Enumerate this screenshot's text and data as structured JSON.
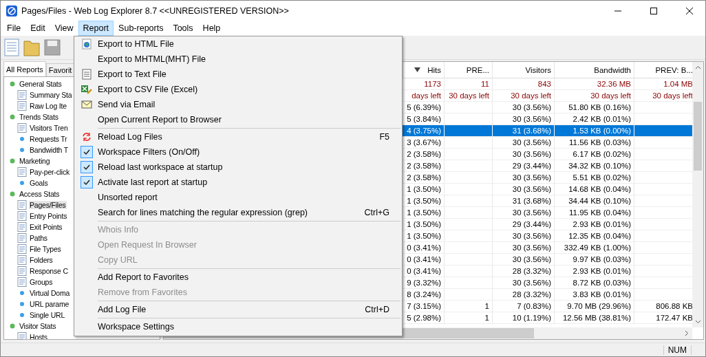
{
  "window": {
    "title": "Pages/Files - Web Log Explorer 8.7 <<UNREGISTERED VERSION>>"
  },
  "menubar": [
    {
      "label": "File",
      "selected": false
    },
    {
      "label": "Edit",
      "selected": false
    },
    {
      "label": "View",
      "selected": false
    },
    {
      "label": "Report",
      "selected": true
    },
    {
      "label": "Sub-reports",
      "selected": false
    },
    {
      "label": "Tools",
      "selected": false
    },
    {
      "label": "Help",
      "selected": false
    }
  ],
  "sidebar": {
    "tabs": [
      {
        "label": "All Reports",
        "selected": true
      },
      {
        "label": "Favorit",
        "selected": false
      }
    ],
    "tree": [
      {
        "label": "General Stats",
        "children": [
          {
            "label": "Summary Sta",
            "kind": "icon",
            "selected": false
          },
          {
            "label": "Raw Log Ite",
            "kind": "icon",
            "selected": false
          }
        ]
      },
      {
        "label": "Trends Stats",
        "children": [
          {
            "label": "Visitors Tren",
            "kind": "icon",
            "selected": false
          },
          {
            "label": "Requests Tr",
            "kind": "dot",
            "selected": false
          },
          {
            "label": "Bandwidth T",
            "kind": "dot",
            "selected": false
          }
        ]
      },
      {
        "label": "Marketing",
        "children": [
          {
            "label": "Pay-per-click",
            "kind": "icon",
            "selected": false
          },
          {
            "label": "Goals",
            "kind": "dot",
            "selected": false
          }
        ]
      },
      {
        "label": "Access Stats",
        "children": [
          {
            "label": "Pages/Files",
            "kind": "icon",
            "selected": true
          },
          {
            "label": "Entry Points",
            "kind": "icon",
            "selected": false
          },
          {
            "label": "Exit Points",
            "kind": "icon",
            "selected": false
          },
          {
            "label": "Paths",
            "kind": "icon",
            "selected": false
          },
          {
            "label": "File Types",
            "kind": "icon",
            "selected": false
          },
          {
            "label": "Folders",
            "kind": "icon",
            "selected": false
          },
          {
            "label": "Response C",
            "kind": "icon",
            "selected": false
          },
          {
            "label": "Groups",
            "kind": "icon",
            "selected": false
          },
          {
            "label": "Virtual Doma",
            "kind": "dot",
            "selected": false
          },
          {
            "label": "URL parame",
            "kind": "dot",
            "selected": false
          },
          {
            "label": "Single URL",
            "kind": "dot",
            "selected": false
          }
        ]
      },
      {
        "label": "Visitor Stats",
        "children": [
          {
            "label": "Hosts",
            "kind": "icon",
            "selected": false
          }
        ]
      }
    ]
  },
  "menu": {
    "groups": [
      [
        {
          "label": "Export to HTML File",
          "checked": false,
          "disabled": false
        },
        {
          "label": "Export to MHTML(MHT) File",
          "checked": false,
          "disabled": false
        },
        {
          "label": "Export to Text File",
          "checked": false,
          "disabled": false
        },
        {
          "label": "Export to CSV File (Excel)",
          "checked": false,
          "disabled": false
        },
        {
          "label": "Send via Email",
          "checked": false,
          "disabled": false
        },
        {
          "label": "Open Current Report to Browser",
          "checked": false,
          "disabled": false
        }
      ],
      [
        {
          "label": "Reload Log Files",
          "shortcut": "F5",
          "checked": false,
          "disabled": false
        },
        {
          "label": "Workspace Filters (On/Off)",
          "checked": true,
          "disabled": false
        },
        {
          "label": "Reload last workspace at startup",
          "checked": true,
          "disabled": false
        },
        {
          "label": "Activate last report at startup",
          "checked": true,
          "disabled": false
        },
        {
          "label": "Unsorted report",
          "checked": false,
          "disabled": false
        },
        {
          "label": "Search for lines matching the regular expression (grep)",
          "shortcut": "Ctrl+G",
          "checked": false,
          "disabled": false
        }
      ],
      [
        {
          "label": "Whois Info",
          "checked": false,
          "disabled": true
        },
        {
          "label": "Open Request In Browser",
          "checked": false,
          "disabled": true
        },
        {
          "label": "Copy URL",
          "checked": false,
          "disabled": true
        }
      ],
      [
        {
          "label": "Add Report to Favorites",
          "checked": false,
          "disabled": false
        },
        {
          "label": "Remove from Favorites",
          "checked": false,
          "disabled": true
        }
      ],
      [
        {
          "label": "Add Log File",
          "shortcut": "Ctrl+D",
          "checked": false,
          "disabled": false
        }
      ],
      [
        {
          "label": "Workspace Settings",
          "checked": false,
          "disabled": false
        }
      ]
    ]
  },
  "table": {
    "columns": [
      "Hits",
      "PRE...",
      "Visitors",
      "Bandwidth",
      "PREV: B..."
    ],
    "totals": [
      "1173",
      "11",
      "843",
      "32.36 MB",
      "1.04 MB"
    ],
    "trial": [
      "days left",
      "30 days left",
      "30 days left",
      "30 days left",
      "30 days left"
    ],
    "rows": [
      {
        "cells": [
          "5 (6.39%)",
          "",
          "30 (3.56%)",
          "51.80 KB (0.16%)",
          ""
        ],
        "selected": false
      },
      {
        "cells": [
          "5 (3.84%)",
          "",
          "30 (3.56%)",
          "2.42 KB (0.01%)",
          ""
        ],
        "selected": false
      },
      {
        "cells": [
          "4 (3.75%)",
          "",
          "31 (3.68%)",
          "1.53 KB (0.00%)",
          ""
        ],
        "selected": true
      },
      {
        "cells": [
          "3 (3.67%)",
          "",
          "30 (3.56%)",
          "11.56 KB (0.03%)",
          ""
        ],
        "selected": false
      },
      {
        "cells": [
          "2 (3.58%)",
          "",
          "30 (3.56%)",
          "6.17 KB (0.02%)",
          ""
        ],
        "selected": false
      },
      {
        "cells": [
          "2 (3.58%)",
          "",
          "29 (3.44%)",
          "34.32 KB (0.10%)",
          ""
        ],
        "selected": false
      },
      {
        "cells": [
          "2 (3.58%)",
          "",
          "30 (3.56%)",
          "5.51 KB (0.02%)",
          ""
        ],
        "selected": false
      },
      {
        "cells": [
          "1 (3.50%)",
          "",
          "30 (3.56%)",
          "14.68 KB (0.04%)",
          ""
        ],
        "selected": false
      },
      {
        "cells": [
          "1 (3.50%)",
          "",
          "31 (3.68%)",
          "34.44 KB (0.10%)",
          ""
        ],
        "selected": false
      },
      {
        "cells": [
          "1 (3.50%)",
          "",
          "30 (3.56%)",
          "11.95 KB (0.04%)",
          ""
        ],
        "selected": false
      },
      {
        "cells": [
          "1 (3.50%)",
          "",
          "29 (3.44%)",
          "2.93 KB (0.01%)",
          ""
        ],
        "selected": false
      },
      {
        "cells": [
          "1 (3.50%)",
          "",
          "30 (3.56%)",
          "12.35 KB (0.04%)",
          ""
        ],
        "selected": false
      },
      {
        "cells": [
          "0 (3.41%)",
          "",
          "30 (3.56%)",
          "332.49 KB (1.00%)",
          ""
        ],
        "selected": false
      },
      {
        "cells": [
          "0 (3.41%)",
          "",
          "30 (3.56%)",
          "9.97 KB (0.03%)",
          ""
        ],
        "selected": false
      },
      {
        "cells": [
          "0 (3.41%)",
          "",
          "28 (3.32%)",
          "2.93 KB (0.01%)",
          ""
        ],
        "selected": false
      },
      {
        "cells": [
          "9 (3.32%)",
          "",
          "30 (3.56%)",
          "8.72 KB (0.03%)",
          ""
        ],
        "selected": false
      },
      {
        "cells": [
          "8 (3.24%)",
          "",
          "28 (3.32%)",
          "3.83 KB (0.01%)",
          ""
        ],
        "selected": false
      },
      {
        "cells": [
          "7 (3.15%)",
          "1",
          "7 (0.83%)",
          "9.70 MB (29.96%)",
          "806.88 KB"
        ],
        "selected": false
      },
      {
        "cells": [
          "5 (2.98%)",
          "1",
          "10 (1.19%)",
          "12.56 MB (38.81%)",
          "172.47 KB"
        ],
        "selected": false
      }
    ]
  },
  "status_bar": {
    "indicator": "NUM"
  }
}
